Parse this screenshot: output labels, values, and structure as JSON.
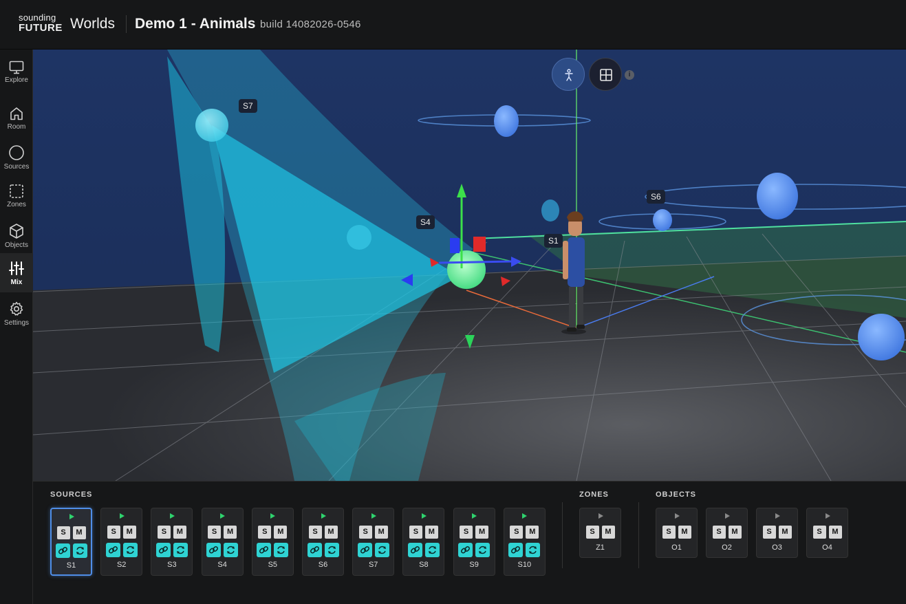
{
  "header": {
    "logo_top": "sounding",
    "logo_bottom": "FUTURE",
    "section": "Worlds",
    "project": "Demo 1 - Animals",
    "build": "build 14082026-0546"
  },
  "sidebar": {
    "items": [
      {
        "label": "Explore",
        "icon": "monitor-icon"
      },
      {
        "label": "Room",
        "icon": "home-icon"
      },
      {
        "label": "Sources",
        "icon": "circle-icon"
      },
      {
        "label": "Zones",
        "icon": "dashed-square-icon"
      },
      {
        "label": "Objects",
        "icon": "cube-icon"
      },
      {
        "label": "Mix",
        "icon": "sliders-icon",
        "active": true
      },
      {
        "label": "Settings",
        "icon": "gear-icon"
      }
    ]
  },
  "viewport": {
    "labels": {
      "s7": "S7",
      "s6": "S6",
      "s4": "S4",
      "s1": "S1"
    },
    "view_modes": [
      {
        "icon": "person-icon",
        "active": true
      },
      {
        "icon": "grid-icon",
        "active": false
      }
    ],
    "info": "i"
  },
  "mixer": {
    "sources_title": "SOURCES",
    "zones_title": "ZONES",
    "objects_title": "OBJECTS",
    "solo_label": "S",
    "mute_label": "M",
    "sources": [
      "S1",
      "S2",
      "S3",
      "S4",
      "S5",
      "S6",
      "S7",
      "S8",
      "S9",
      "S10"
    ],
    "selected_source": "S1",
    "zones": [
      "Z1"
    ],
    "objects": [
      "O1",
      "O2",
      "O3",
      "O4"
    ]
  },
  "colors": {
    "accent": "#4f8ee8",
    "play_active": "#2fd36e",
    "cyan_button": "#2fd3d3",
    "beam": "#19d6f5",
    "sky": "#1c2f5a",
    "zone_green": "#2e7a4a"
  }
}
